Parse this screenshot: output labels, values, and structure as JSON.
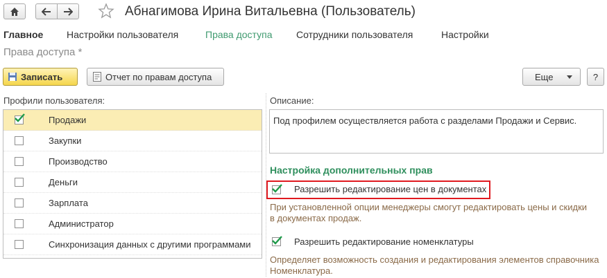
{
  "window": {
    "title": "Абнагимова Ирина Витальевна (Пользователь)",
    "icons": [
      "home-icon",
      "arrow-left-icon",
      "arrow-right-icon",
      "star-icon"
    ]
  },
  "nav": {
    "tabs": [
      "Главное",
      "Настройки пользователя",
      "Права доступа",
      "Сотрудники пользователя",
      "Настройки"
    ],
    "active_index": 2
  },
  "subtitle": "Права доступа *",
  "toolbar": {
    "save_label": "Записать",
    "report_label": "Отчет по правам доступа",
    "more_label": "Еще",
    "help_label": "?"
  },
  "profiles": {
    "label": "Профили пользователя:",
    "items": [
      {
        "label": "Продажи",
        "checked": true
      },
      {
        "label": "Закупки",
        "checked": false
      },
      {
        "label": "Производство",
        "checked": false
      },
      {
        "label": "Деньги",
        "checked": false
      },
      {
        "label": "Зарплата",
        "checked": false
      },
      {
        "label": "Администратор",
        "checked": false
      },
      {
        "label": "Синхронизация данных с другими программами",
        "checked": false
      }
    ]
  },
  "description": {
    "label": "Описание:",
    "text": "Под профилем осуществляется работа с разделами Продажи и Сервис."
  },
  "extra_rights": {
    "title": "Настройка дополнительных прав",
    "option1_label": "Разрешить редактирование цен в документах",
    "option1_checked": true,
    "option1_hint_line1": "При установленной опции менеджеры смогут редактировать цены и скидки",
    "option1_hint_line2": "в документах продаж.",
    "option2_label": "Разрешить редактирование номенклатуры",
    "option2_checked": true,
    "option2_hint_line1": "Определяет возможность создания и редактирования элементов справочника",
    "option2_hint_line2": "Номенклатура."
  },
  "colors": {
    "accent_green": "#2f8f5d",
    "selected_row": "#fbedb4",
    "highlight_border": "#e0191f"
  }
}
